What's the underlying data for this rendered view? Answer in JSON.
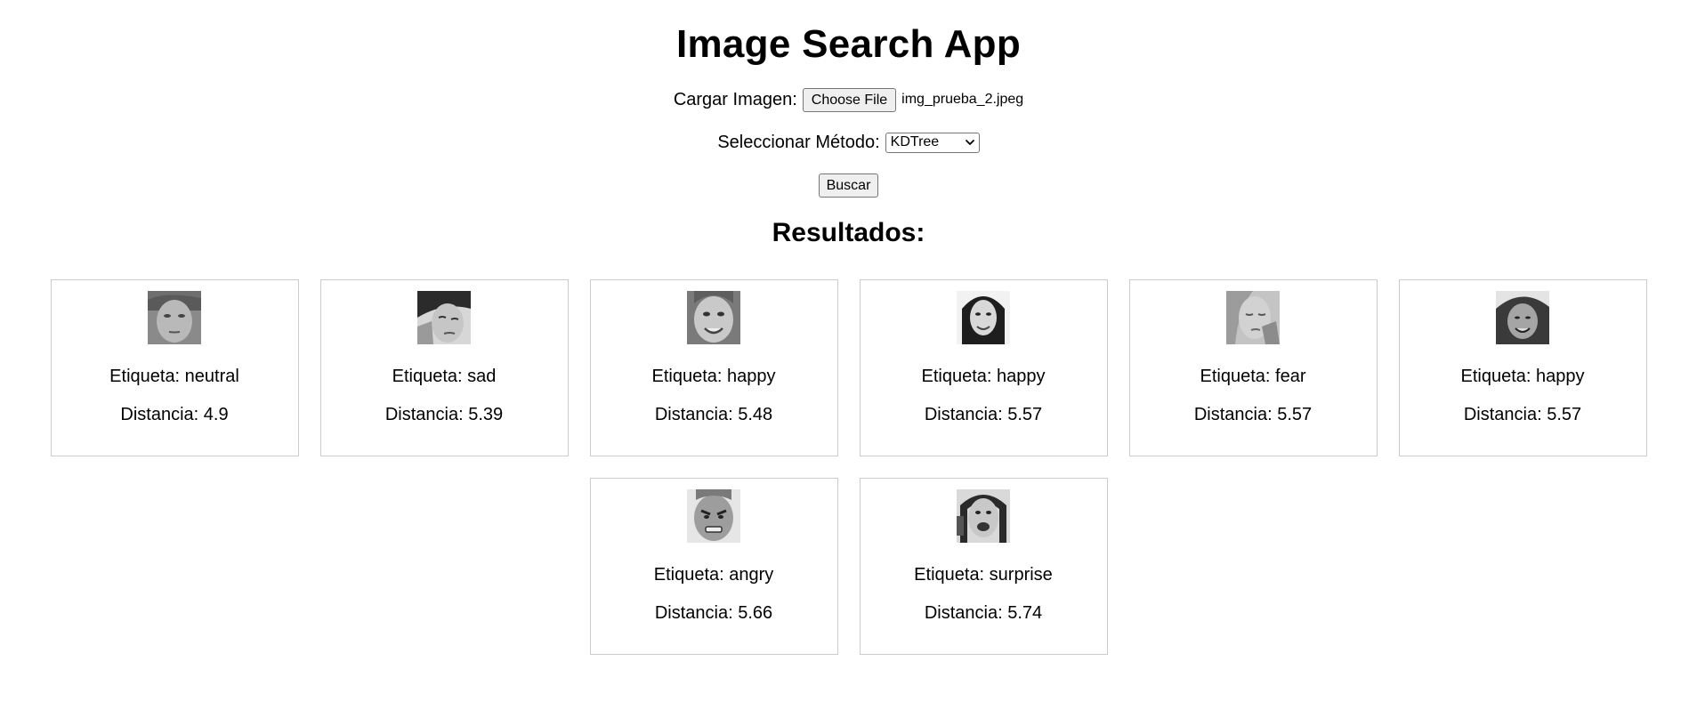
{
  "header": {
    "title": "Image Search App"
  },
  "upload": {
    "label": "Cargar Imagen:",
    "button_label": "Choose File",
    "file_name": "img_prueba_2.jpeg"
  },
  "method": {
    "label": "Seleccionar Método:",
    "selected": "KDTree"
  },
  "search": {
    "button_label": "Buscar"
  },
  "results": {
    "title": "Resultados:",
    "items": [
      {
        "label": "Etiqueta: neutral",
        "distance": "Distancia: 4.9",
        "face": "neutral-face-image"
      },
      {
        "label": "Etiqueta: sad",
        "distance": "Distancia: 5.39",
        "face": "sad-face-image"
      },
      {
        "label": "Etiqueta: happy",
        "distance": "Distancia: 5.48",
        "face": "happy-face-image"
      },
      {
        "label": "Etiqueta: happy",
        "distance": "Distancia: 5.57",
        "face": "happy-face-image"
      },
      {
        "label": "Etiqueta: fear",
        "distance": "Distancia: 5.57",
        "face": "fear-face-image"
      },
      {
        "label": "Etiqueta: happy",
        "distance": "Distancia: 5.57",
        "face": "happy-face-image"
      },
      {
        "label": "Etiqueta: angry",
        "distance": "Distancia: 5.66",
        "face": "angry-face-image"
      },
      {
        "label": "Etiqueta: surprise",
        "distance": "Distancia: 5.74",
        "face": "surprise-face-image"
      }
    ]
  },
  "colors": {
    "card_border": "#cccccc",
    "button_bg": "#efefef",
    "button_border": "#767676"
  }
}
